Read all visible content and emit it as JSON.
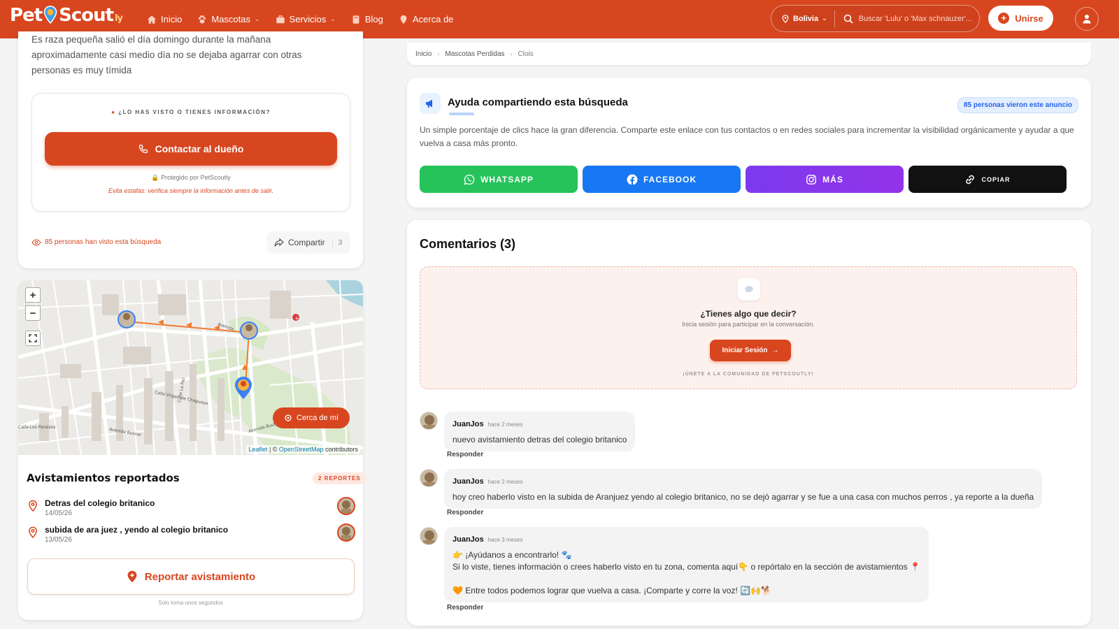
{
  "header": {
    "logo_main": "Pet",
    "logo_second": "Scout",
    "logo_suffix": "ly",
    "nav": [
      {
        "label": "Inicio",
        "icon": "home-icon"
      },
      {
        "label": "Mascotas",
        "icon": "paw-icon",
        "dropdown": true
      },
      {
        "label": "Servicios",
        "icon": "briefcase-icon",
        "dropdown": true
      },
      {
        "label": "Blog",
        "icon": "book-icon"
      },
      {
        "label": "Acerca de",
        "icon": "info-pin-icon"
      }
    ],
    "location": "Bolivia",
    "search_placeholder": "Buscar 'Lulu' o 'Max schnauzer'...",
    "join_label": "Unirse",
    "accent_color": "#d8461f"
  },
  "left": {
    "description": "Es raza pequeña salió el día domingo durante la mañana aproximadamente casi medio día no se dejaba agarrar con otras personas es muy tímida",
    "contact_question": "¿LO HAS VISTO O TIENES INFORMACIÓN?",
    "contact_button": "Contactar al dueño",
    "protected": "Protegido por PetScoutly",
    "warning": "Evita estafas: verifica siempre la información antes de salir.",
    "views": "85 personas han visto esta búsqueda",
    "share_label": "Compartir",
    "share_count": "3"
  },
  "map": {
    "near_button": "Cerca de mí",
    "attribution_leaflet": "Leaflet",
    "attribution_mid": " | © ",
    "attribution_osm": "OpenStreetMap",
    "attribution_end": " contributors",
    "zoom_in": "+",
    "zoom_out": "−",
    "street_labels": [
      "Avenida",
      "Calle Virgen de Chaguaya",
      "Calle La Paz",
      "Calle Los Paraisos",
      "Avenida Bolivar",
      "Avenida Busterman"
    ]
  },
  "sightings": {
    "title": "Avistamientos reportados",
    "badge": "2 REPORTES",
    "items": [
      {
        "title": "Detras del colegio britanico",
        "date": "14/05/26"
      },
      {
        "title": "subida de ara juez , yendo al colegio britanico",
        "date": "13/05/26"
      }
    ],
    "report_button": "Reportar avistamiento",
    "report_note": "Solo toma unos segundos"
  },
  "breadcrumb": [
    "Inicio",
    "Mascotas Perdidas",
    "Clois"
  ],
  "share": {
    "title": "Ayuda compartiendo esta búsqueda",
    "views_badge": "85 personas vieron este anuncio",
    "description": "Un simple porcentaje de clics hace la gran diferencia. Comparte este enlace con tus contactos o en redes sociales para incrementar la visibilidad orgánicamente y ayudar a que vuelva a casa más pronto.",
    "buttons": [
      {
        "label": "WHATSAPP",
        "color": "#25c35a"
      },
      {
        "label": "FACEBOOK",
        "color": "#1877f2"
      },
      {
        "label": "MÁS",
        "color": "#8a2be2"
      },
      {
        "label": "COPIAR",
        "color": "#111111"
      }
    ]
  },
  "comments": {
    "title": "Comentarios (3)",
    "prompt_question": "¿Tienes algo que decir?",
    "prompt_sub": "Inicia sesión para participar en la conversación.",
    "login_button": "Iniciar Sesión",
    "join_note": "¡ÚNETE A LA COMUNIDAD DE PETSCOUTLY!",
    "reply_label": "Responder",
    "items": [
      {
        "author": "JuanJos",
        "time": "hace 2 meses",
        "lines": [
          "nuevo avistamiento detras del colegio britanico"
        ]
      },
      {
        "author": "JuanJos",
        "time": "hace 2 meses",
        "lines": [
          "hoy creo haberlo visto en la subida de Aranjuez yendo al colegio britanico, no se dejó agarrar y se fue a una casa con muchos perros , ya reporte a la dueña"
        ]
      },
      {
        "author": "JuanJos",
        "time": "hace 3 meses",
        "lines": [
          "👉 ¡Ayúdanos a encontrarlo! 🐾",
          "Si lo viste, tienes información o crees haberlo visto en tu zona, comenta aquí👇 o repórtalo en la sección de avistamientos 📍",
          "",
          "🧡 Entre todos podemos lograr que vuelva a casa. ¡Comparte y corre la voz! 🔄🙌🐕"
        ]
      }
    ]
  }
}
